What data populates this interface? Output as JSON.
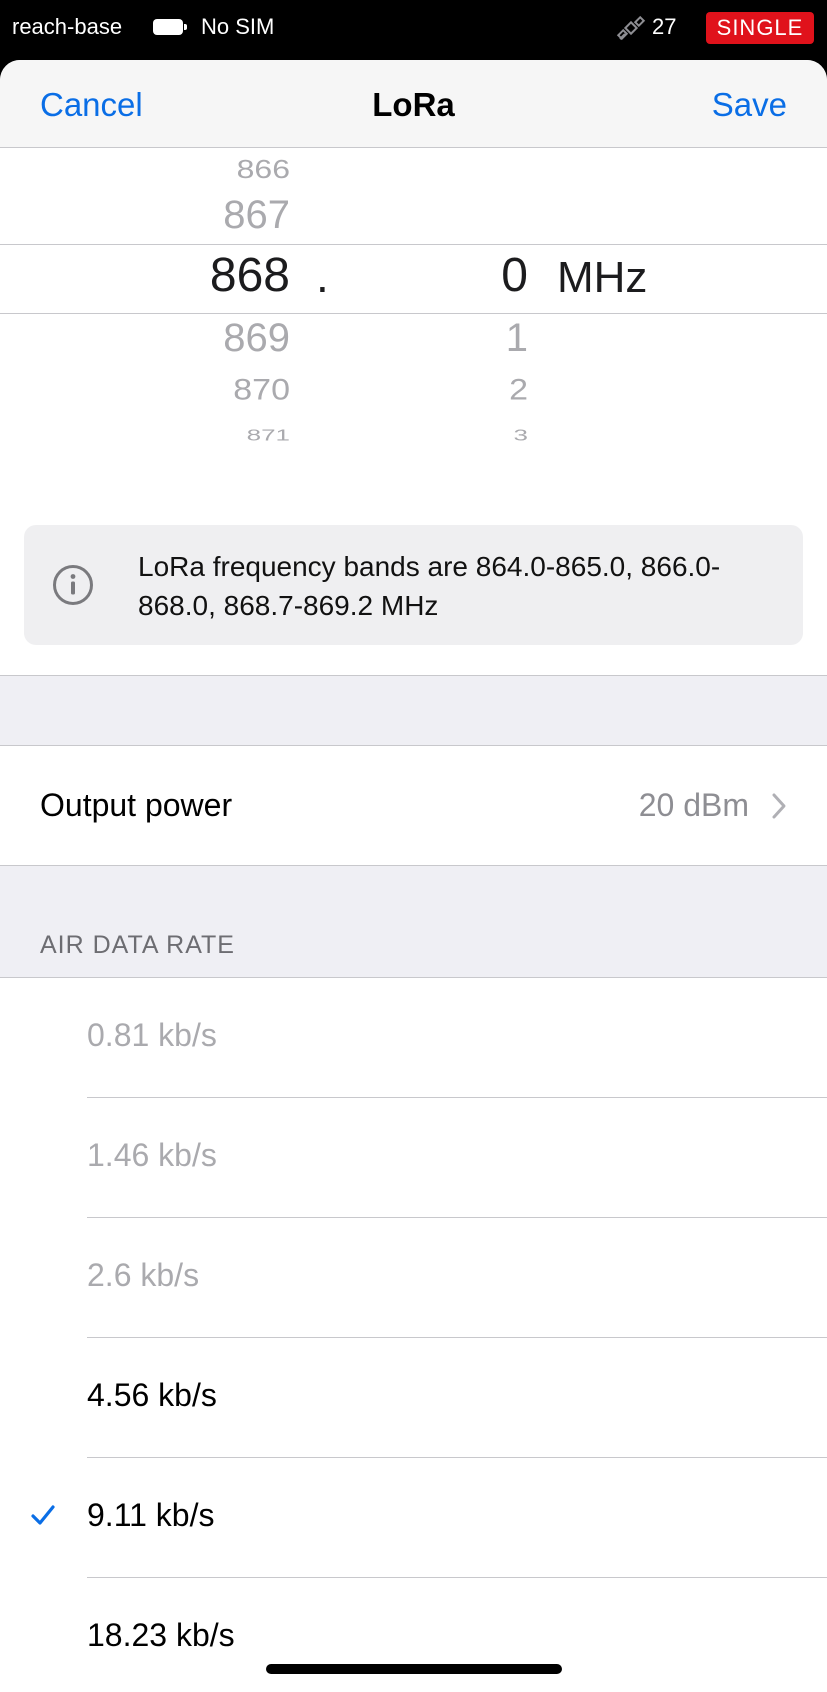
{
  "status_bar": {
    "device_name": "reach-base",
    "sim": "No SIM",
    "satellite_count": "27",
    "solution_status": "SINGLE",
    "solution_color": "#e0121b"
  },
  "nav": {
    "cancel_label": "Cancel",
    "title": "LoRa",
    "save_label": "Save",
    "accent_color": "#0a6ee6"
  },
  "frequency_picker": {
    "integer_options": [
      "866",
      "867",
      "868",
      "869",
      "870",
      "871"
    ],
    "integer_selected": "868",
    "separator": ".",
    "decimal_options": [
      "0",
      "1",
      "2",
      "3"
    ],
    "decimal_selected": "0",
    "unit": "MHz"
  },
  "info": {
    "icon": "info-icon",
    "text": "LoRa frequency bands are 864.0-865.0, 866.0-868.0, 868.7-869.2 MHz"
  },
  "output_power": {
    "label": "Output power",
    "value": "20 dBm",
    "icon": "chevron-right-icon"
  },
  "air_data_rate": {
    "header": "AIR DATA RATE",
    "options": [
      {
        "label": "0.81 kb/s",
        "enabled": false,
        "selected": false
      },
      {
        "label": "1.46 kb/s",
        "enabled": false,
        "selected": false
      },
      {
        "label": "2.6 kb/s",
        "enabled": false,
        "selected": false
      },
      {
        "label": "4.56 kb/s",
        "enabled": true,
        "selected": false
      },
      {
        "label": "9.11 kb/s",
        "enabled": true,
        "selected": true
      },
      {
        "label": "18.23 kb/s",
        "enabled": true,
        "selected": false
      }
    ]
  }
}
